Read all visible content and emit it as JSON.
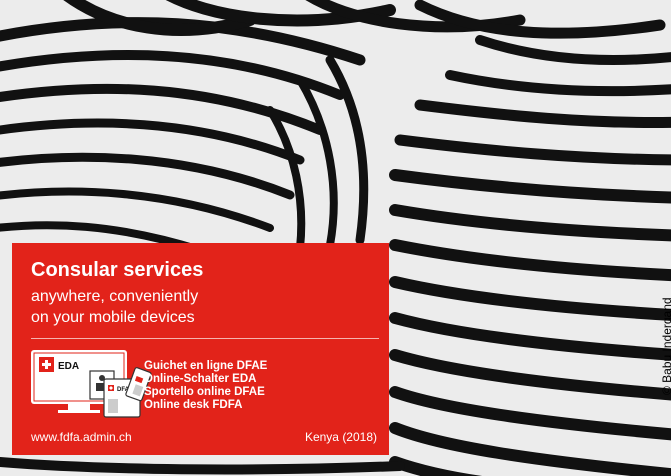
{
  "card": {
    "title": "Consular services",
    "subtitle_line1": "anywhere, conveniently",
    "subtitle_line2": "on your mobile devices",
    "icon": {
      "monitor_label": "EDA",
      "tablet_label": "DFAE"
    },
    "online_desk_names": [
      "Guichet en ligne DFAE",
      "Online-Schalter EDA",
      "Sportello online DFAE",
      "Online desk FDFA"
    ],
    "website": "www.fdfa.admin.ch",
    "photo_caption": "Kenya (2018)"
  },
  "photo_credit": "© Babu Indergand",
  "colors": {
    "card_red": "#e2231a",
    "stripe_dark": "#111111",
    "stripe_light": "#e9e9e9"
  },
  "icons": [
    "swiss-cross-icon",
    "monitor-icon",
    "tablet-icon",
    "phone-icon",
    "document-icon"
  ]
}
